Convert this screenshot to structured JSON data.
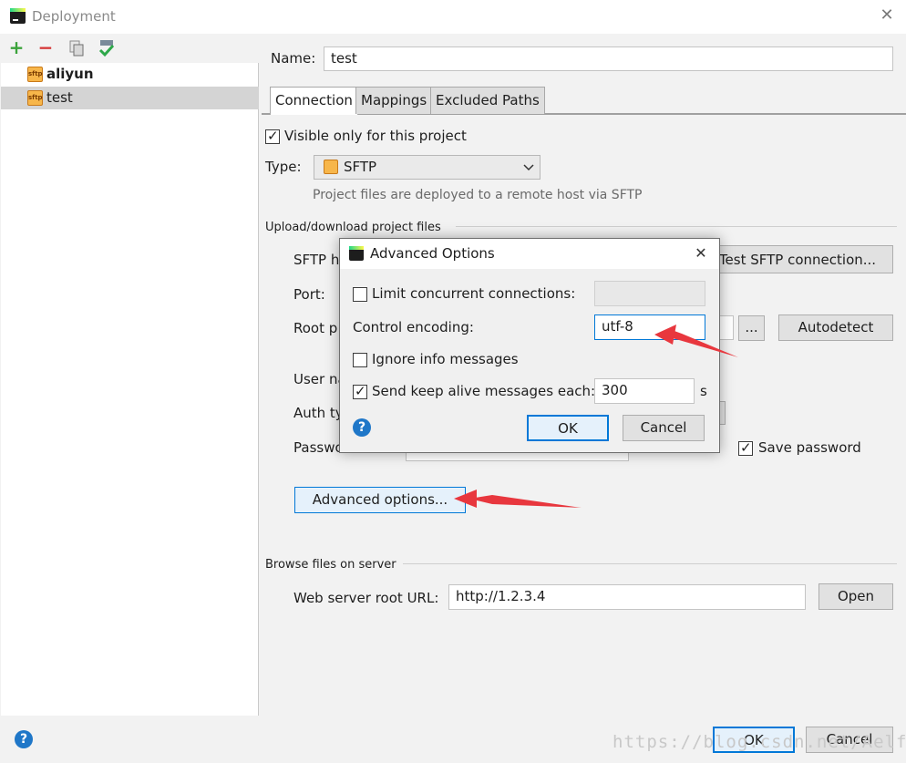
{
  "window": {
    "title": "Deployment",
    "close_glyph": "✕"
  },
  "toolbar": {
    "add": "+",
    "remove": "−"
  },
  "servers": [
    {
      "name": "aliyun",
      "badge": "sftp"
    },
    {
      "name": "test",
      "badge": "sftp"
    }
  ],
  "config": {
    "name_label": "Name:",
    "name_value": "test",
    "tabs": [
      "Connection",
      "Mappings",
      "Excluded Paths"
    ],
    "visible_only_label": "Visible only for this project",
    "visible_only_checked": true,
    "type_label": "Type:",
    "type_value": "SFTP",
    "type_hint": "Project files are deployed to a remote host via SFTP",
    "upload_section": "Upload/download project files",
    "sftp_host_label": "SFTP h",
    "test_button": "Test SFTP connection...",
    "port_label": "Port:",
    "root_path_label": "Root p",
    "browse_button": "...",
    "autodetect_button": "Autodetect",
    "user_name_label": "User na",
    "auth_type_label": "Auth ty",
    "password_label": "Passwo",
    "save_password_label": "Save password",
    "save_password_checked": true,
    "advanced_button": "Advanced options...",
    "browse_section": "Browse files on server",
    "web_root_label": "Web server root URL:",
    "web_root_value": "http://1.2.3.4",
    "open_button": "Open"
  },
  "dialog": {
    "title": "Advanced Options",
    "close_glyph": "✕",
    "limit_label": "Limit concurrent connections:",
    "limit_checked": false,
    "limit_value": "",
    "encoding_label": "Control encoding:",
    "encoding_value": "utf-8",
    "ignore_label": "Ignore info messages",
    "ignore_checked": false,
    "keepalive_label": "Send keep alive messages each:",
    "keepalive_checked": true,
    "keepalive_value": "300",
    "keepalive_unit": "s",
    "ok_button": "OK",
    "cancel_button": "Cancel",
    "help_glyph": "?"
  },
  "footer": {
    "ok_button": "OK",
    "cancel_button": "Cancel",
    "help_glyph": "?"
  },
  "watermark": "https://blog.csdn.net/Aelfale",
  "colors": {
    "accent": "#0078d7",
    "annotation_arrow": "#e8373e",
    "add": "#3ba33b",
    "remove": "#d63939"
  }
}
